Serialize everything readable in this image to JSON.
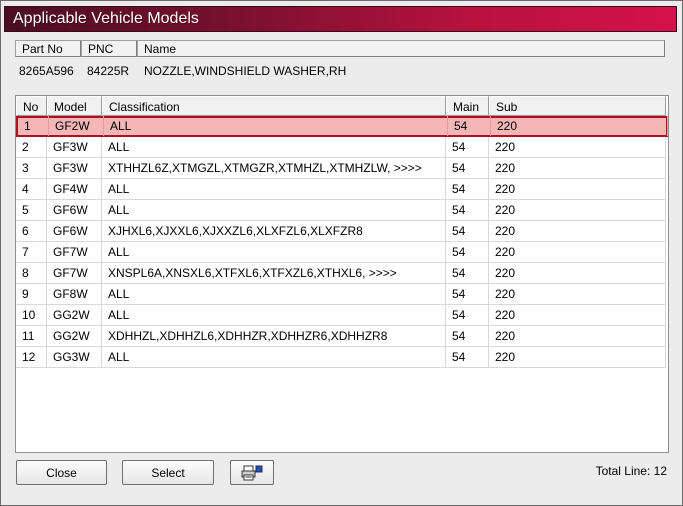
{
  "window": {
    "title": "Applicable Vehicle Models"
  },
  "part": {
    "headers": [
      "Part No",
      "PNC",
      "Name"
    ],
    "values": [
      "8265A596",
      "84225R",
      "NOZZLE,WINDSHIELD WASHER,RH"
    ]
  },
  "grid": {
    "headers": [
      "No",
      "Model",
      "Classification",
      "Main",
      "Sub"
    ],
    "selected_index": 0,
    "rows": [
      [
        "1",
        "GF2W",
        "ALL",
        "54",
        "220"
      ],
      [
        "2",
        "GF3W",
        "ALL",
        "54",
        "220"
      ],
      [
        "3",
        "GF3W",
        "XTHHZL6Z,XTMGZL,XTMGZR,XTMHZL,XTMHZLW,  >>>>",
        "54",
        "220"
      ],
      [
        "4",
        "GF4W",
        "ALL",
        "54",
        "220"
      ],
      [
        "5",
        "GF6W",
        "ALL",
        "54",
        "220"
      ],
      [
        "6",
        "GF6W",
        "XJHXL6,XJXXL6,XJXXZL6,XLXFZL6,XLXFZR8",
        "54",
        "220"
      ],
      [
        "7",
        "GF7W",
        "ALL",
        "54",
        "220"
      ],
      [
        "8",
        "GF7W",
        "XNSPL6A,XNSXL6,XTFXL6,XTFXZL6,XTHXL6,  >>>>",
        "54",
        "220"
      ],
      [
        "9",
        "GF8W",
        "ALL",
        "54",
        "220"
      ],
      [
        "10",
        "GG2W",
        "ALL",
        "54",
        "220"
      ],
      [
        "11",
        "GG2W",
        "XDHHZL,XDHHZL6,XDHHZR,XDHHZR6,XDHHZR8",
        "54",
        "220"
      ],
      [
        "12",
        "GG3W",
        "ALL",
        "54",
        "220"
      ]
    ]
  },
  "footer": {
    "close_label": "Close",
    "select_label": "Select",
    "print_icon": "printer-icon",
    "total_label": "Total Line: 12"
  },
  "colors": {
    "title_gradient_start": "#4a0e22",
    "title_gradient_end": "#d4124a",
    "selection_fill": "#f4b6b6",
    "selection_border": "#b01020"
  }
}
